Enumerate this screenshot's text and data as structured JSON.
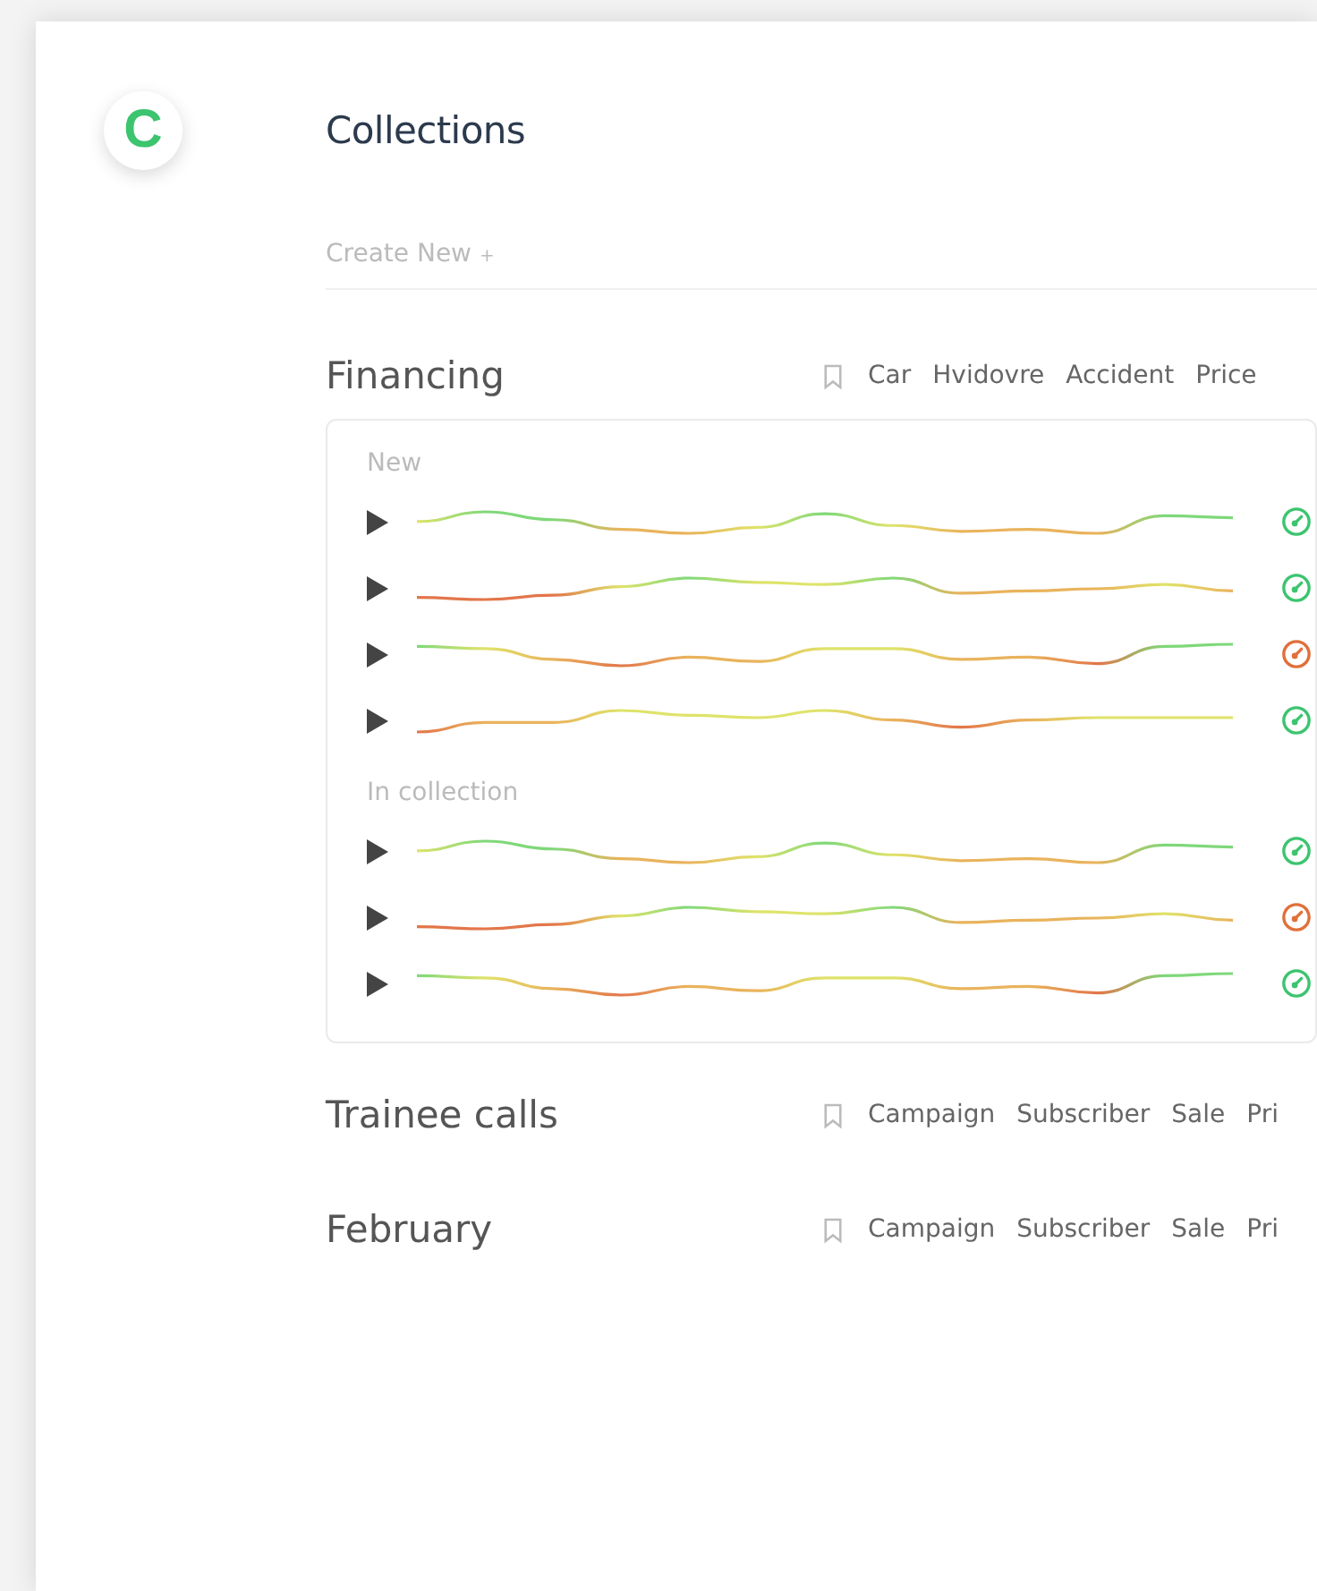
{
  "app": {
    "logo": "C",
    "title": "Collections"
  },
  "create_new": {
    "label": "Create New",
    "icon_char": "+"
  },
  "collections": [
    {
      "name": "Financing",
      "tags": [
        "Car",
        "Hvidovre",
        "Accident",
        "Price"
      ],
      "groups": [
        {
          "label": "New",
          "calls": [
            {
              "color": "#3cc46f"
            },
            {
              "color": "#3cc46f"
            },
            {
              "color": "#e0703a"
            },
            {
              "color": "#3cc46f"
            }
          ]
        },
        {
          "label": "In collection",
          "calls": [
            {
              "color": "#3cc46f"
            },
            {
              "color": "#e0703a"
            },
            {
              "color": "#3cc46f"
            }
          ]
        }
      ]
    },
    {
      "name": "Trainee calls",
      "tags": [
        "Campaign",
        "Subscriber",
        "Sale",
        "Pri"
      ]
    },
    {
      "name": "February",
      "tags": [
        "Campaign",
        "Subscriber",
        "Sale",
        "Pri"
      ]
    }
  ]
}
